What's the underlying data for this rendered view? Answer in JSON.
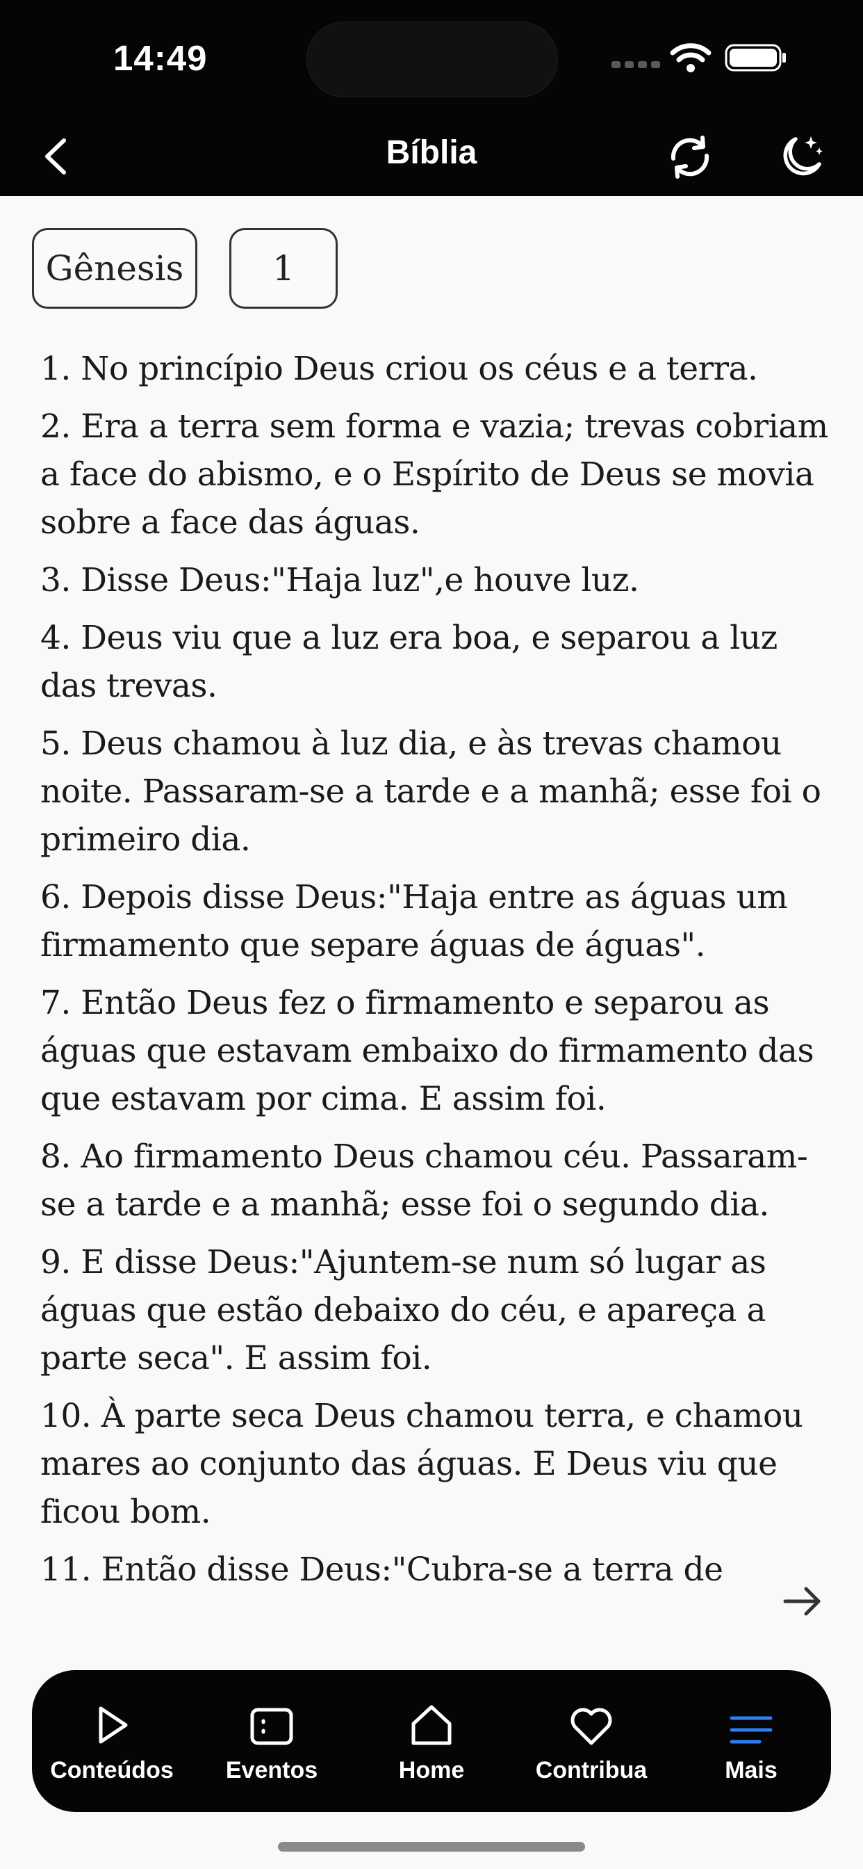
{
  "status_bar": {
    "time": "14:49"
  },
  "nav": {
    "title": "Bíblia"
  },
  "selectors": {
    "book": "Gênesis",
    "chapter": "1"
  },
  "verses": [
    "1. No princípio Deus criou os céus e a terra.",
    "2. Era a terra sem forma e vazia; trevas cobriam a face do abismo, e o Espírito de Deus se movia sobre a face das águas.",
    "3. Disse Deus:\"Haja luz\",e houve luz.",
    "4. Deus viu que a luz era boa, e separou a luz das trevas.",
    "5. Deus chamou à luz dia, e às trevas chamou noite. Passaram-se a tarde e a manhã; esse foi o primeiro dia.",
    "6. Depois disse Deus:\"Haja entre as águas um firmamento que separe águas de águas\".",
    "7. Então Deus fez o firmamento e separou as águas que estavam embaixo do firmamento das que estavam por cima. E assim foi.",
    "8. Ao firmamento Deus chamou céu. Passaram-se a tarde e a manhã; esse foi o segundo dia.",
    "9. E disse Deus:\"Ajuntem-se num só lugar as águas que estão debaixo do céu, e apareça a parte seca\". E assim foi.",
    "10. À parte seca Deus chamou terra, e chamou mares ao conjunto das águas. E Deus viu que ficou bom.",
    "11. Então disse Deus:\"Cubra-se a terra de"
  ],
  "tabs": [
    {
      "label": "Conteúdos",
      "icon": "play-icon",
      "active": false
    },
    {
      "label": "Eventos",
      "icon": "events-icon",
      "active": false
    },
    {
      "label": "Home",
      "icon": "home-icon",
      "active": false
    },
    {
      "label": "Contribua",
      "icon": "heart-icon",
      "active": false
    },
    {
      "label": "Mais",
      "icon": "menu-icon",
      "active": true
    }
  ],
  "colors": {
    "bar_bg": "#050505",
    "active_tab": "#2f7df6",
    "page_bg": "#f9f9f9"
  }
}
